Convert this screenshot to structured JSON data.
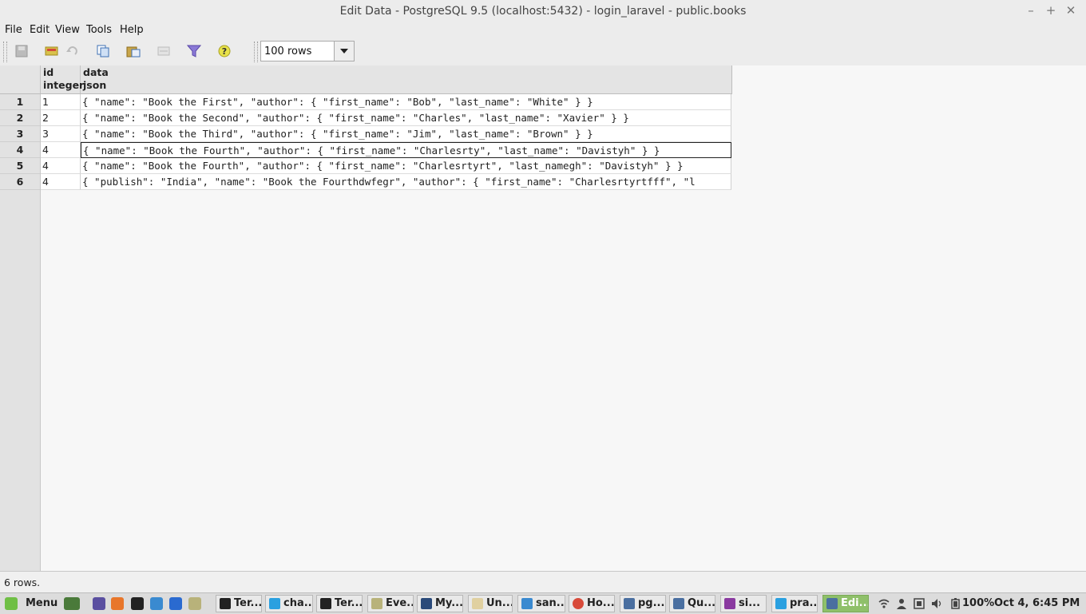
{
  "window": {
    "title": "Edit Data - PostgreSQL 9.5 (localhost:5432) - login_laravel - public.books"
  },
  "menu": [
    "File",
    "Edit",
    "View",
    "Tools",
    "Help"
  ],
  "toolbar": {
    "rows_select": "100 rows"
  },
  "grid": {
    "columns": [
      {
        "name": "id",
        "type": "integer"
      },
      {
        "name": "data",
        "type": "json"
      }
    ],
    "rows": [
      {
        "num": "1",
        "id": "1",
        "data": "{ \"name\": \"Book the First\", \"author\": { \"first_name\": \"Bob\", \"last_name\": \"White\" } }"
      },
      {
        "num": "2",
        "id": "2",
        "data": "{ \"name\": \"Book the Second\", \"author\": { \"first_name\": \"Charles\", \"last_name\": \"Xavier\" } }"
      },
      {
        "num": "3",
        "id": "3",
        "data": "{ \"name\": \"Book the Third\", \"author\": { \"first_name\": \"Jim\", \"last_name\": \"Brown\" } }"
      },
      {
        "num": "4",
        "id": "4",
        "data": "{ \"name\": \"Book the Fourth\", \"author\": { \"first_name\": \"Charlesrty\", \"last_name\": \"Davistyh\" } }"
      },
      {
        "num": "5",
        "id": "4",
        "data": "{ \"name\": \"Book the Fourth\", \"author\": { \"first_name\": \"Charlesrtyrt\", \"last_namegh\": \"Davistyh\" } }"
      },
      {
        "num": "6",
        "id": "4",
        "data": "{ \"publish\": \"India\", \"name\": \"Book the Fourthdwfegr\", \"author\": { \"first_name\": \"Charlesrtyrtfff\", \"l"
      }
    ]
  },
  "status": "6 rows.",
  "taskbar": {
    "menu_label": "Menu",
    "tasks": [
      "Ter...",
      "cha...",
      "Ter...",
      "Eve...",
      "My...",
      "Un...",
      "san...",
      "Ho...",
      "pg...",
      "Qu...",
      "si...",
      "pra...",
      "Edi..."
    ],
    "battery": "100%",
    "clock": "Oct 4, 6:45 PM"
  }
}
